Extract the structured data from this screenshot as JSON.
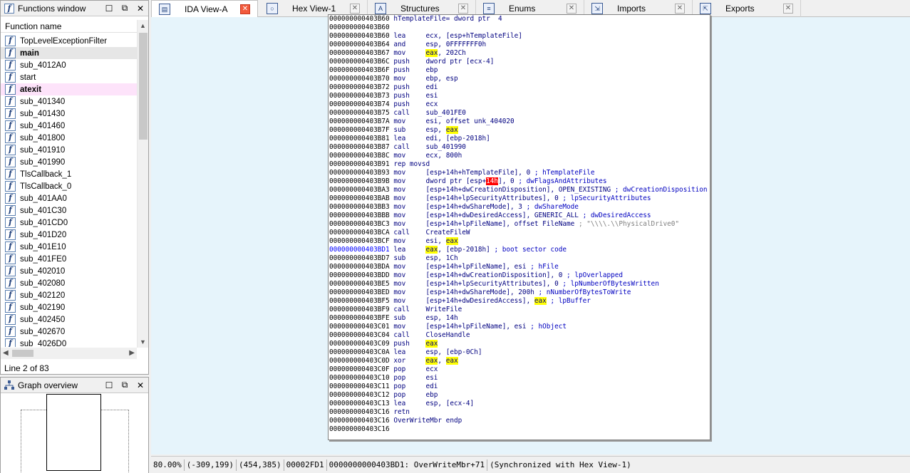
{
  "functions_window": {
    "title": "Functions window",
    "column_header": "Function name",
    "line_status": "Line 2 of 83",
    "functions": [
      {
        "name": "TopLevelExceptionFilter",
        "state": ""
      },
      {
        "name": "main",
        "state": "sel"
      },
      {
        "name": "sub_4012A0",
        "state": ""
      },
      {
        "name": "start",
        "state": ""
      },
      {
        "name": "atexit",
        "state": "pink"
      },
      {
        "name": "sub_401340",
        "state": ""
      },
      {
        "name": "sub_401430",
        "state": ""
      },
      {
        "name": "sub_401460",
        "state": ""
      },
      {
        "name": "sub_401800",
        "state": ""
      },
      {
        "name": "sub_401910",
        "state": ""
      },
      {
        "name": "sub_401990",
        "state": ""
      },
      {
        "name": "TlsCallback_1",
        "state": ""
      },
      {
        "name": "TlsCallback_0",
        "state": ""
      },
      {
        "name": "sub_401AA0",
        "state": ""
      },
      {
        "name": "sub_401C30",
        "state": ""
      },
      {
        "name": "sub_401CD0",
        "state": ""
      },
      {
        "name": "sub_401D20",
        "state": ""
      },
      {
        "name": "sub_401E10",
        "state": ""
      },
      {
        "name": "sub_401FE0",
        "state": ""
      },
      {
        "name": "sub_402010",
        "state": ""
      },
      {
        "name": "sub_402080",
        "state": ""
      },
      {
        "name": "sub_402120",
        "state": ""
      },
      {
        "name": "sub_402190",
        "state": ""
      },
      {
        "name": "sub_402450",
        "state": ""
      },
      {
        "name": "sub_402670",
        "state": ""
      },
      {
        "name": "sub_4026D0",
        "state": ""
      }
    ]
  },
  "graph_overview": {
    "title": "Graph overview"
  },
  "tabs": [
    {
      "label": "IDA View-A",
      "active": true,
      "icon": "ida-view-icon"
    },
    {
      "label": "Hex View-1",
      "active": false,
      "icon": "hex-view-icon"
    },
    {
      "label": "Structures",
      "active": false,
      "icon": "structures-icon"
    },
    {
      "label": "Enums",
      "active": false,
      "icon": "enums-icon"
    },
    {
      "label": "Imports",
      "active": false,
      "icon": "imports-icon"
    },
    {
      "label": "Exports",
      "active": false,
      "icon": "exports-icon"
    }
  ],
  "disassembly": [
    [
      {
        "t": "000000000403B60 ",
        "c": "addr"
      },
      {
        "t": "hTemplateFile= dword ptr  4",
        "c": ""
      }
    ],
    [
      {
        "t": "000000000403B60",
        "c": "addr"
      }
    ],
    [
      {
        "t": "000000000403B60 ",
        "c": "addr"
      },
      {
        "t": "lea     ",
        "c": "mn"
      },
      {
        "t": "ecx, [esp+hTemplateFile]",
        "c": ""
      }
    ],
    [
      {
        "t": "000000000403B64 ",
        "c": "addr"
      },
      {
        "t": "and     ",
        "c": "mn"
      },
      {
        "t": "esp, 0FFFFFFF0h",
        "c": ""
      }
    ],
    [
      {
        "t": "000000000403B67 ",
        "c": "addr"
      },
      {
        "t": "mov     ",
        "c": "mn"
      },
      {
        "t": "eax",
        "c": "hl"
      },
      {
        "t": ", 202Ch",
        "c": ""
      }
    ],
    [
      {
        "t": "000000000403B6C ",
        "c": "addr"
      },
      {
        "t": "push    ",
        "c": "mn"
      },
      {
        "t": "dword ptr [ecx-4]",
        "c": ""
      }
    ],
    [
      {
        "t": "000000000403B6F ",
        "c": "addr"
      },
      {
        "t": "push    ",
        "c": "mn"
      },
      {
        "t": "ebp",
        "c": ""
      }
    ],
    [
      {
        "t": "000000000403B70 ",
        "c": "addr"
      },
      {
        "t": "mov     ",
        "c": "mn"
      },
      {
        "t": "ebp, esp",
        "c": ""
      }
    ],
    [
      {
        "t": "000000000403B72 ",
        "c": "addr"
      },
      {
        "t": "push    ",
        "c": "mn"
      },
      {
        "t": "edi",
        "c": ""
      }
    ],
    [
      {
        "t": "000000000403B73 ",
        "c": "addr"
      },
      {
        "t": "push    ",
        "c": "mn"
      },
      {
        "t": "esi",
        "c": ""
      }
    ],
    [
      {
        "t": "000000000403B74 ",
        "c": "addr"
      },
      {
        "t": "push    ",
        "c": "mn"
      },
      {
        "t": "ecx",
        "c": ""
      }
    ],
    [
      {
        "t": "000000000403B75 ",
        "c": "addr"
      },
      {
        "t": "call    ",
        "c": "mn"
      },
      {
        "t": "sub_401FE0",
        "c": ""
      }
    ],
    [
      {
        "t": "000000000403B7A ",
        "c": "addr"
      },
      {
        "t": "mov     ",
        "c": "mn"
      },
      {
        "t": "esi, offset unk_404020",
        "c": ""
      }
    ],
    [
      {
        "t": "000000000403B7F ",
        "c": "addr"
      },
      {
        "t": "sub     ",
        "c": "mn"
      },
      {
        "t": "esp, ",
        "c": ""
      },
      {
        "t": "eax",
        "c": "hl"
      }
    ],
    [
      {
        "t": "000000000403B81 ",
        "c": "addr"
      },
      {
        "t": "lea     ",
        "c": "mn"
      },
      {
        "t": "edi, [ebp-2018h]",
        "c": ""
      }
    ],
    [
      {
        "t": "000000000403B87 ",
        "c": "addr"
      },
      {
        "t": "call    ",
        "c": "mn"
      },
      {
        "t": "sub_401990",
        "c": ""
      }
    ],
    [
      {
        "t": "000000000403B8C ",
        "c": "addr"
      },
      {
        "t": "mov     ",
        "c": "mn"
      },
      {
        "t": "ecx, 800h",
        "c": ""
      }
    ],
    [
      {
        "t": "000000000403B91 ",
        "c": "addr"
      },
      {
        "t": "rep movsd",
        "c": "mn"
      }
    ],
    [
      {
        "t": "000000000403B93 ",
        "c": "addr"
      },
      {
        "t": "mov     ",
        "c": "mn"
      },
      {
        "t": "[esp+14h+hTemplateFile], 0 ",
        "c": ""
      },
      {
        "t": "; hTemplateFile",
        "c": "cm"
      }
    ],
    [
      {
        "t": "000000000403B9B ",
        "c": "addr"
      },
      {
        "t": "mov     ",
        "c": "mn"
      },
      {
        "t": "dword ptr [esp+",
        "c": ""
      },
      {
        "t": "14h",
        "c": "hlr"
      },
      {
        "t": "], 0 ",
        "c": ""
      },
      {
        "t": "; dwFlagsAndAttributes",
        "c": "cm"
      }
    ],
    [
      {
        "t": "000000000403BA3 ",
        "c": "addr"
      },
      {
        "t": "mov     ",
        "c": "mn"
      },
      {
        "t": "[esp+14h+dwCreationDisposition], OPEN_EXISTING ",
        "c": ""
      },
      {
        "t": "; dwCreationDisposition",
        "c": "cm"
      }
    ],
    [
      {
        "t": "000000000403BAB ",
        "c": "addr"
      },
      {
        "t": "mov     ",
        "c": "mn"
      },
      {
        "t": "[esp+14h+lpSecurityAttributes], 0 ",
        "c": ""
      },
      {
        "t": "; lpSecurityAttributes",
        "c": "cm"
      }
    ],
    [
      {
        "t": "000000000403BB3 ",
        "c": "addr"
      },
      {
        "t": "mov     ",
        "c": "mn"
      },
      {
        "t": "[esp+14h+dwShareMode], 3 ",
        "c": ""
      },
      {
        "t": "; dwShareMode",
        "c": "cm"
      }
    ],
    [
      {
        "t": "000000000403BBB ",
        "c": "addr"
      },
      {
        "t": "mov     ",
        "c": "mn"
      },
      {
        "t": "[esp+14h+dwDesiredAccess], GENERIC_ALL ",
        "c": ""
      },
      {
        "t": "; dwDesiredAccess",
        "c": "cm"
      }
    ],
    [
      {
        "t": "000000000403BC3 ",
        "c": "addr"
      },
      {
        "t": "mov     ",
        "c": "mn"
      },
      {
        "t": "[esp+14h+lpFileName], offset FileName ",
        "c": ""
      },
      {
        "t": "; \"\\\\\\\\.\\\\PhysicalDrive0\"",
        "c": "gr"
      }
    ],
    [
      {
        "t": "000000000403BCA ",
        "c": "addr"
      },
      {
        "t": "call    ",
        "c": "mn"
      },
      {
        "t": "CreateFileW",
        "c": ""
      }
    ],
    [
      {
        "t": "000000000403BCF ",
        "c": "addr"
      },
      {
        "t": "mov     ",
        "c": "mn"
      },
      {
        "t": "esi, ",
        "c": ""
      },
      {
        "t": "eax",
        "c": "hl"
      }
    ],
    [
      {
        "t": "000000000403BD1 ",
        "c": "addr cur"
      },
      {
        "t": "lea     ",
        "c": "mn"
      },
      {
        "t": "eax",
        "c": "hl"
      },
      {
        "t": ", [ebp-2018h] ",
        "c": ""
      },
      {
        "t": "; boot sector code",
        "c": "cm"
      }
    ],
    [
      {
        "t": "000000000403BD7 ",
        "c": "addr"
      },
      {
        "t": "sub     ",
        "c": "mn"
      },
      {
        "t": "esp, 1Ch",
        "c": ""
      }
    ],
    [
      {
        "t": "000000000403BDA ",
        "c": "addr"
      },
      {
        "t": "mov     ",
        "c": "mn"
      },
      {
        "t": "[esp+14h+lpFileName], esi ",
        "c": ""
      },
      {
        "t": "; hFile",
        "c": "cm"
      }
    ],
    [
      {
        "t": "000000000403BDD ",
        "c": "addr"
      },
      {
        "t": "mov     ",
        "c": "mn"
      },
      {
        "t": "[esp+14h+dwCreationDisposition], 0 ",
        "c": ""
      },
      {
        "t": "; lpOverlapped",
        "c": "cm"
      }
    ],
    [
      {
        "t": "000000000403BE5 ",
        "c": "addr"
      },
      {
        "t": "mov     ",
        "c": "mn"
      },
      {
        "t": "[esp+14h+lpSecurityAttributes], 0 ",
        "c": ""
      },
      {
        "t": "; lpNumberOfBytesWritten",
        "c": "cm"
      }
    ],
    [
      {
        "t": "000000000403BED ",
        "c": "addr"
      },
      {
        "t": "mov     ",
        "c": "mn"
      },
      {
        "t": "[esp+14h+dwShareMode], 200h ",
        "c": ""
      },
      {
        "t": "; nNumberOfBytesToWrite",
        "c": "cm"
      }
    ],
    [
      {
        "t": "000000000403BF5 ",
        "c": "addr"
      },
      {
        "t": "mov     ",
        "c": "mn"
      },
      {
        "t": "[esp+14h+dwDesiredAccess], ",
        "c": ""
      },
      {
        "t": "eax",
        "c": "hl"
      },
      {
        "t": " ",
        "c": ""
      },
      {
        "t": "; lpBuffer",
        "c": "cm"
      }
    ],
    [
      {
        "t": "000000000403BF9 ",
        "c": "addr"
      },
      {
        "t": "call    ",
        "c": "mn"
      },
      {
        "t": "WriteFile",
        "c": ""
      }
    ],
    [
      {
        "t": "000000000403BFE ",
        "c": "addr"
      },
      {
        "t": "sub     ",
        "c": "mn"
      },
      {
        "t": "esp, 14h",
        "c": ""
      }
    ],
    [
      {
        "t": "000000000403C01 ",
        "c": "addr"
      },
      {
        "t": "mov     ",
        "c": "mn"
      },
      {
        "t": "[esp+14h+lpFileName], esi ",
        "c": ""
      },
      {
        "t": "; hObject",
        "c": "cm"
      }
    ],
    [
      {
        "t": "000000000403C04 ",
        "c": "addr"
      },
      {
        "t": "call    ",
        "c": "mn"
      },
      {
        "t": "CloseHandle",
        "c": ""
      }
    ],
    [
      {
        "t": "000000000403C09 ",
        "c": "addr"
      },
      {
        "t": "push    ",
        "c": "mn"
      },
      {
        "t": "eax",
        "c": "hl"
      }
    ],
    [
      {
        "t": "000000000403C0A ",
        "c": "addr"
      },
      {
        "t": "lea     ",
        "c": "mn"
      },
      {
        "t": "esp, [ebp-0Ch]",
        "c": ""
      }
    ],
    [
      {
        "t": "000000000403C0D ",
        "c": "addr"
      },
      {
        "t": "xor     ",
        "c": "mn"
      },
      {
        "t": "eax",
        "c": "hl"
      },
      {
        "t": ", ",
        "c": ""
      },
      {
        "t": "eax",
        "c": "hl"
      }
    ],
    [
      {
        "t": "000000000403C0F ",
        "c": "addr"
      },
      {
        "t": "pop     ",
        "c": "mn"
      },
      {
        "t": "ecx",
        "c": ""
      }
    ],
    [
      {
        "t": "000000000403C10 ",
        "c": "addr"
      },
      {
        "t": "pop     ",
        "c": "mn"
      },
      {
        "t": "esi",
        "c": ""
      }
    ],
    [
      {
        "t": "000000000403C11 ",
        "c": "addr"
      },
      {
        "t": "pop     ",
        "c": "mn"
      },
      {
        "t": "edi",
        "c": ""
      }
    ],
    [
      {
        "t": "000000000403C12 ",
        "c": "addr"
      },
      {
        "t": "pop     ",
        "c": "mn"
      },
      {
        "t": "ebp",
        "c": ""
      }
    ],
    [
      {
        "t": "000000000403C13 ",
        "c": "addr"
      },
      {
        "t": "lea     ",
        "c": "mn"
      },
      {
        "t": "esp, [ecx-4]",
        "c": ""
      }
    ],
    [
      {
        "t": "000000000403C16 ",
        "c": "addr"
      },
      {
        "t": "retn",
        "c": "mn"
      }
    ],
    [
      {
        "t": "000000000403C16 ",
        "c": "addr"
      },
      {
        "t": "OverWriteMbr endp",
        "c": ""
      }
    ],
    [
      {
        "t": "000000000403C16",
        "c": "addr"
      }
    ]
  ],
  "statusbar": {
    "zoom": "80.00%",
    "coords1": "(-309,199)",
    "coords2": "(454,385)",
    "offset": "00002FD1",
    "location": "0000000000403BD1: OverWriteMbr+71",
    "sync": "(Synchronized with Hex View-1)"
  },
  "colors": {
    "graph_bg": "#e6f4fb",
    "highlight": "#ffff00",
    "highlight_red": "#ff0000",
    "selected_row": "#e6e6e6",
    "pink_row": "#fde3fa",
    "active_tab_close": "#f25a3c"
  }
}
